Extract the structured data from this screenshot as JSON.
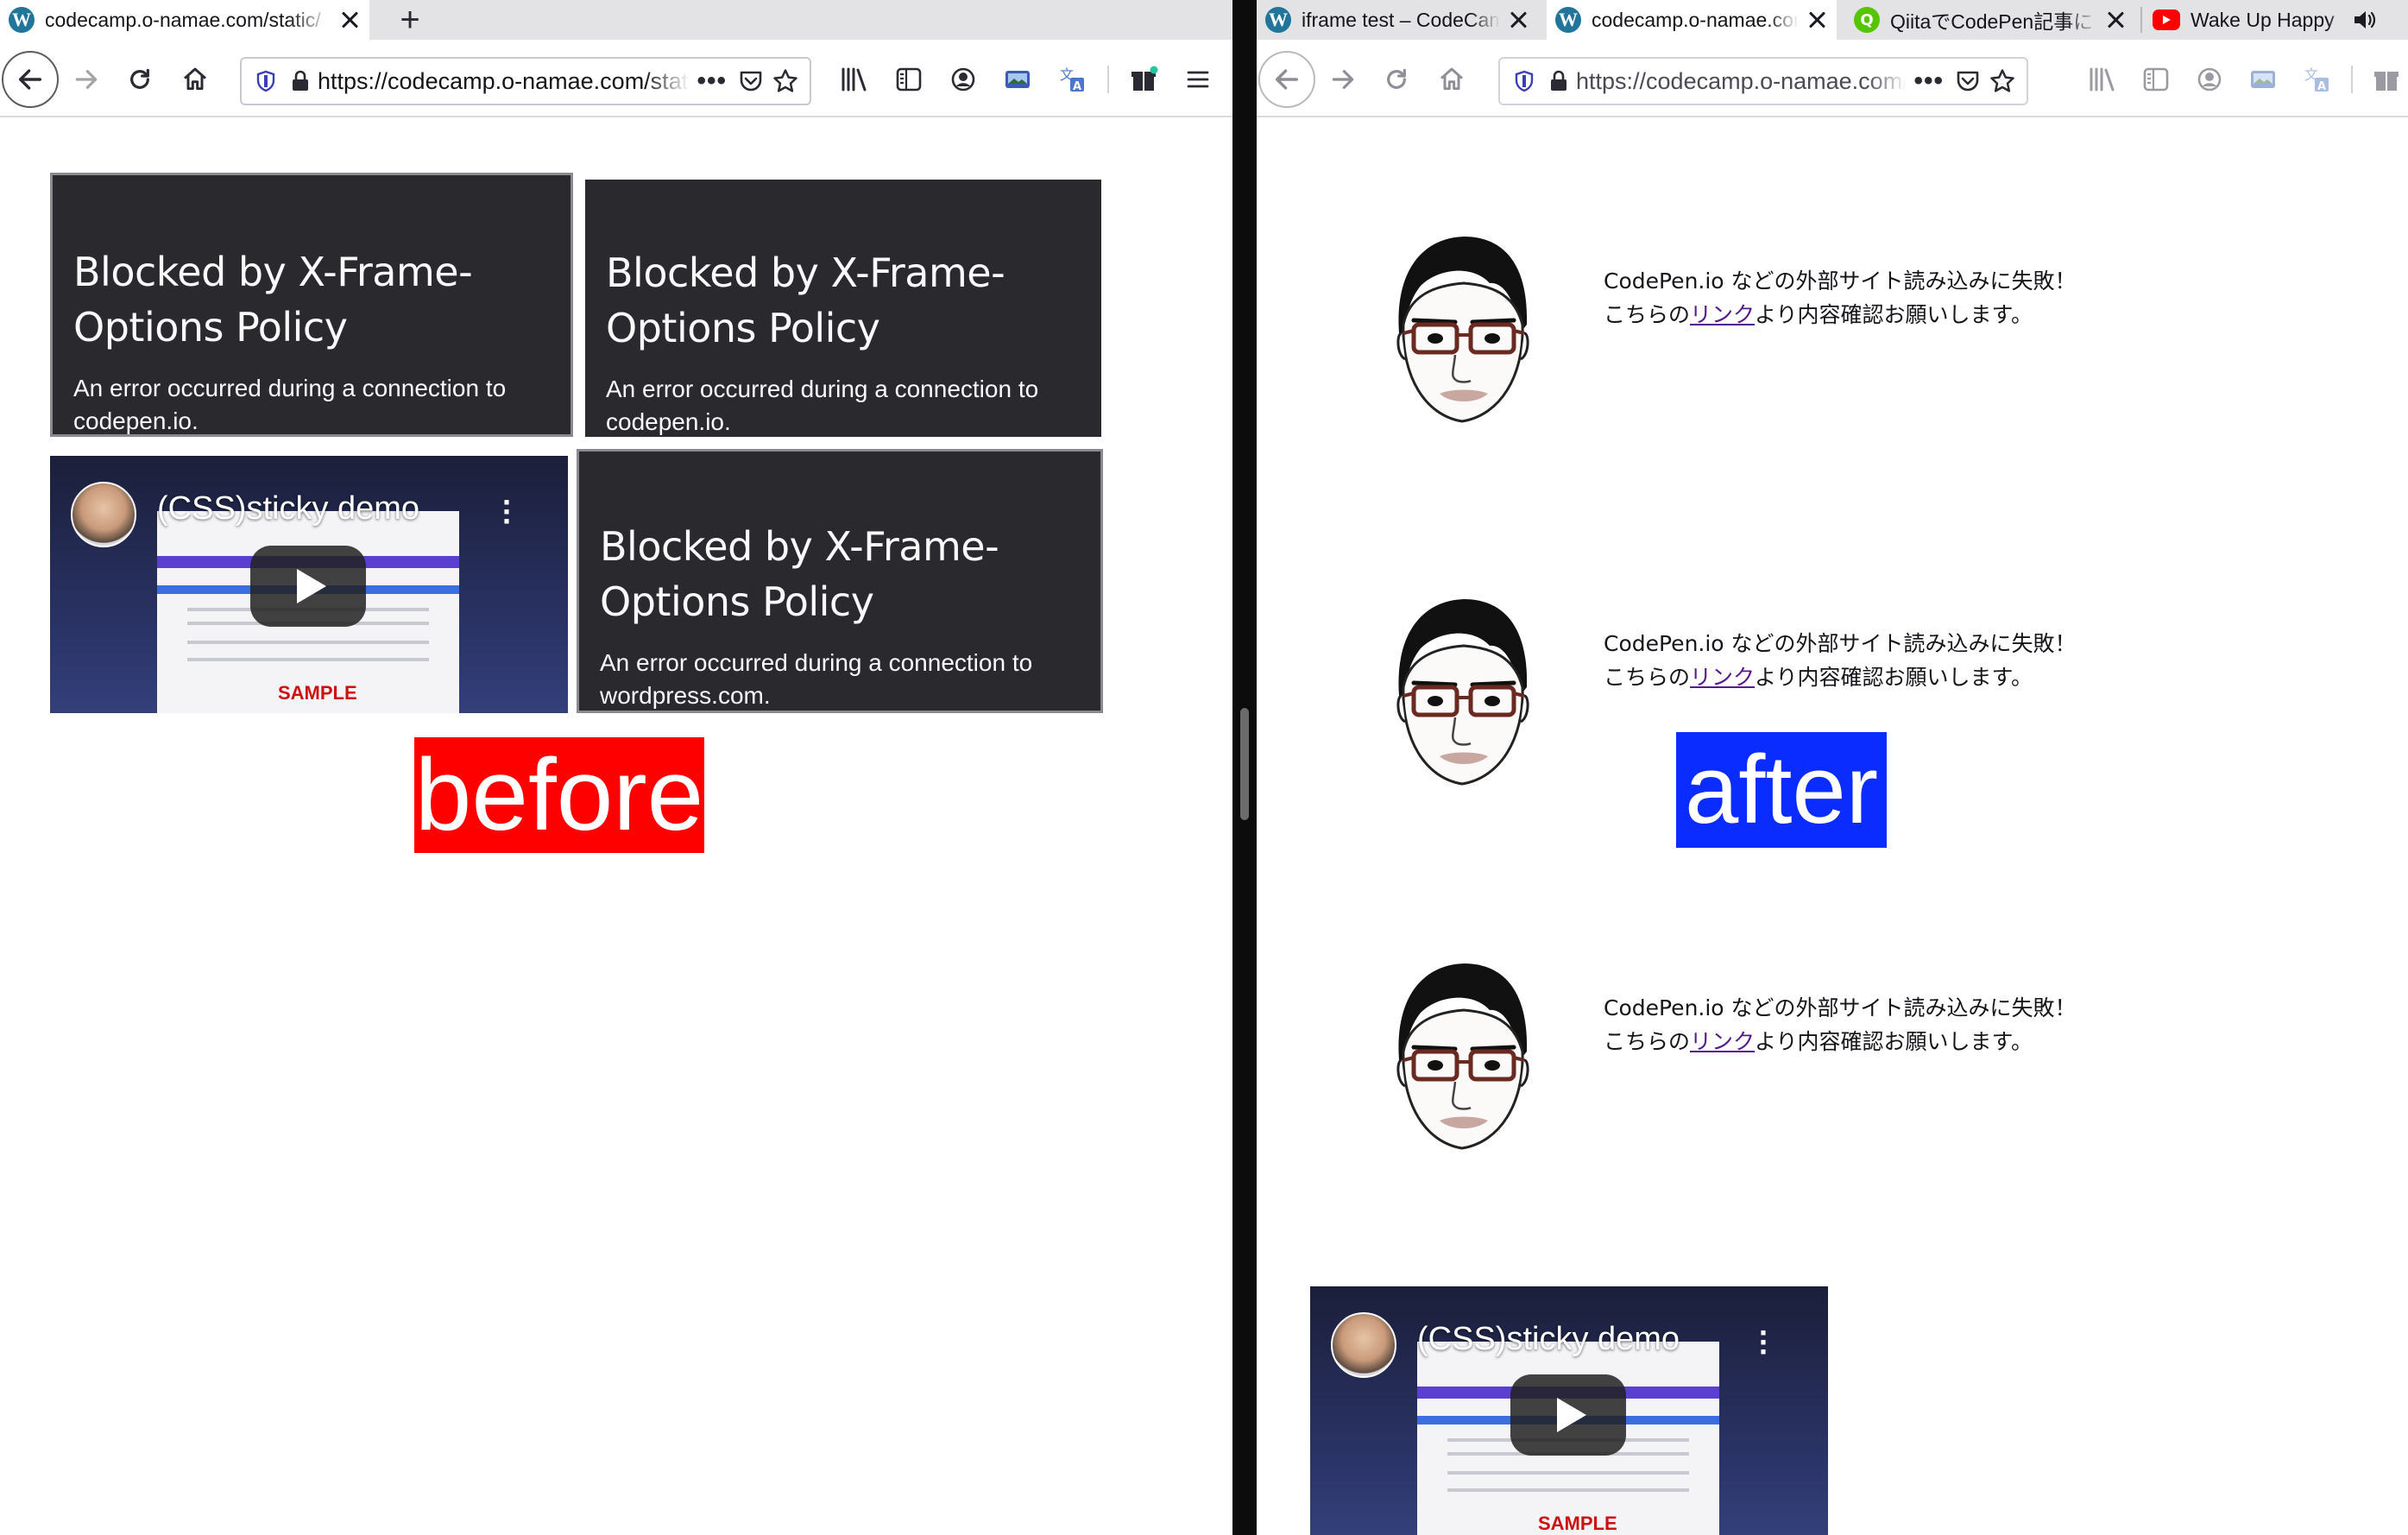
{
  "left_window": {
    "tab": {
      "title": "codecamp.o-namae.com/static/",
      "favicon": "wordpress-icon"
    },
    "new_tab_label": "+",
    "url": "https://codecamp.o-namae.com/static/",
    "blocked_frames": [
      {
        "title": "Blocked by X-Frame-Options Policy",
        "message": "An error occurred during a connection to codepen.io."
      },
      {
        "title": "Blocked by X-Frame-Options Policy",
        "message": "An error occurred during a connection to codepen.io."
      },
      {
        "title": "Blocked by X-Frame-Options Policy",
        "message": "An error occurred during a connection to wordpress.com."
      }
    ],
    "video": {
      "title": "(CSS)sticky demo",
      "sample_label": "SAMPLE"
    },
    "caption": {
      "text": "before",
      "color": "#ff0000"
    }
  },
  "right_window": {
    "tabs": [
      {
        "title": "iframe test – CodeCamp",
        "favicon": "wordpress-icon"
      },
      {
        "title": "codecamp.o-namae.com",
        "favicon": "wordpress-icon"
      },
      {
        "title": "QiitaでCodePen記事に",
        "favicon": "qiita-icon"
      },
      {
        "title": "Wake Up Happy",
        "favicon": "youtube-icon"
      }
    ],
    "url": "https://codecamp.o-namae.com/",
    "fallbacks": [
      {
        "line1": "CodePen.io などの外部サイト読み込みに失敗！",
        "line2_before": "こちらの",
        "link": "リンク",
        "line2_after": "より内容確認お願いします。"
      },
      {
        "line1": "CodePen.io などの外部サイト読み込みに失敗！",
        "line2_before": "こちらの",
        "link": "リンク",
        "line2_after": "より内容確認お願いします。"
      },
      {
        "line1": "CodePen.io などの外部サイト読み込みに失敗！",
        "line2_before": "こちらの",
        "link": "リンク",
        "line2_after": "より内容確認お願いします。"
      }
    ],
    "video": {
      "title": "(CSS)sticky demo",
      "sample_label": "SAMPLE"
    },
    "caption": {
      "text": "after",
      "color": "#0a2cff"
    }
  },
  "colors": {
    "blocked_bg": "#2a2a2e",
    "link": "#551a8b",
    "tabstrip": "#e3e3e6"
  }
}
